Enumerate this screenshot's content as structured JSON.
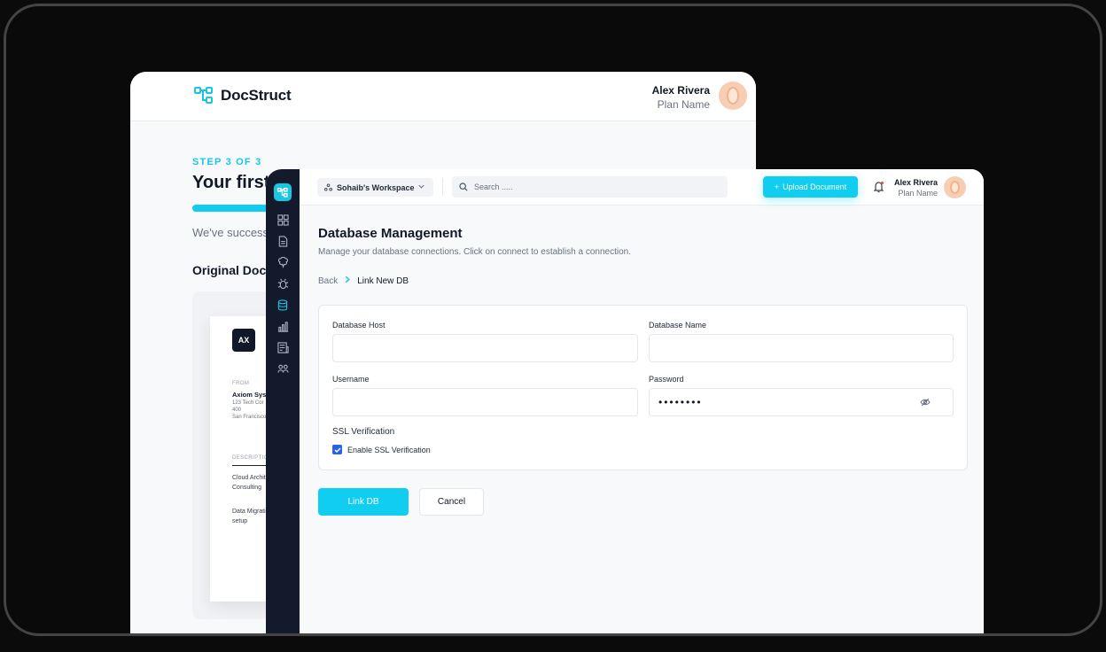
{
  "back_window": {
    "brand": "DocStruct",
    "user_name": "Alex Rivera",
    "user_plan": "Plan Name",
    "step_label": "STEP 3 OF 3",
    "title": "Your first",
    "description": "We've success",
    "section_title": "Original Docu",
    "document": {
      "logo_text": "AX",
      "from_label": "FROM",
      "company": "Axiom Syste",
      "address_line1": "123 Tech Cor",
      "address_line2": "400",
      "address_line3": "San Francisco",
      "description_label": "DESCRIPTION",
      "item1_line1": "Cloud Archit",
      "item1_line2": "Consulting",
      "item2_line1": "Data Migrati",
      "item2_line2": "setup"
    }
  },
  "topbar": {
    "workspace": "Sohaib's Workspace",
    "search_placeholder": "Search .....",
    "upload_label": "Upload Document",
    "user_name": "Alex Rivera",
    "user_plan": "Plan Name"
  },
  "page": {
    "title": "Database Management",
    "description": "Manage your database connections. Click on connect to establish a connection.",
    "breadcrumb_back": "Back",
    "breadcrumb_current": "Link New DB"
  },
  "form": {
    "host_label": "Database Host",
    "host_value": "",
    "name_label": "Database Name",
    "name_value": "",
    "username_label": "Username",
    "username_value": "",
    "password_label": "Password",
    "password_value": "••••••••",
    "ssl_title": "SSL Verification",
    "ssl_checkbox_label": "Enable SSL Verification",
    "ssl_checked": true
  },
  "actions": {
    "link_label": "Link DB",
    "cancel_label": "Cancel"
  },
  "colors": {
    "accent": "#11cdef",
    "sidebar": "#121a2b",
    "checkbox": "#2563eb"
  },
  "sidebar_icons": [
    "dashboard-icon",
    "document-icon",
    "brain-icon",
    "bug-icon",
    "database-icon",
    "chart-icon",
    "report-icon",
    "team-icon"
  ]
}
